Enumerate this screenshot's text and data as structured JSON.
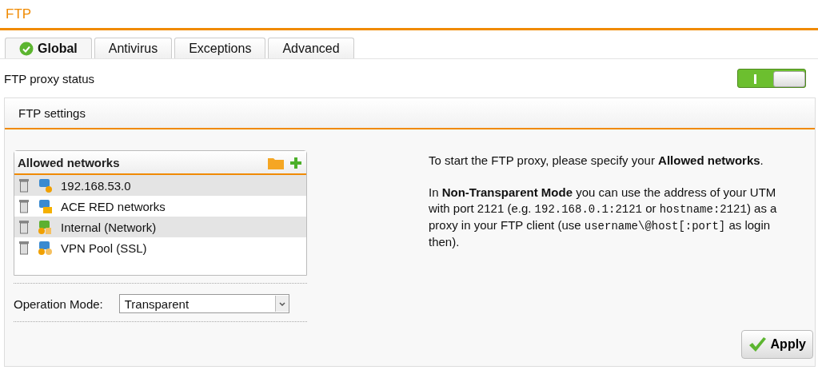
{
  "page_title": "FTP",
  "tabs": [
    {
      "label": "Global",
      "selected": true,
      "status_ok": true
    },
    {
      "label": "Antivirus",
      "selected": false,
      "status_ok": false
    },
    {
      "label": "Exceptions",
      "selected": false,
      "status_ok": false
    },
    {
      "label": "Advanced",
      "selected": false,
      "status_ok": false
    }
  ],
  "proxy_status": {
    "label": "FTP proxy status",
    "on": true
  },
  "panel": {
    "title": "FTP settings",
    "allowed_networks": {
      "title": "Allowed networks",
      "items": [
        {
          "label": "192.168.53.0",
          "kind": "host"
        },
        {
          "label": "ACE RED networks",
          "kind": "group"
        },
        {
          "label": "Internal (Network)",
          "kind": "network"
        },
        {
          "label": "VPN Pool (SSL)",
          "kind": "pool"
        }
      ]
    },
    "operation_mode": {
      "label": "Operation Mode:",
      "value": "Transparent"
    },
    "help": [
      [
        {
          "kind": "text",
          "text": "To start the FTP proxy, please specify your "
        },
        {
          "kind": "bold",
          "text": "Allowed networks"
        },
        {
          "kind": "text",
          "text": "."
        }
      ],
      [
        {
          "kind": "text",
          "text": "In "
        },
        {
          "kind": "bold",
          "text": "Non-Transparent Mode"
        },
        {
          "kind": "text",
          "text": " you can use the address of your UTM with port 2121 (e.g. "
        },
        {
          "kind": "code",
          "text": "192.168.0.1:2121"
        },
        {
          "kind": "text",
          "text": " or "
        },
        {
          "kind": "code",
          "text": "hostname:2121"
        },
        {
          "kind": "text",
          "text": ") as a proxy in your FTP client (use "
        },
        {
          "kind": "code",
          "text": "username\\@host[:port]"
        },
        {
          "kind": "text",
          "text": " as login then)."
        }
      ]
    ],
    "apply": "Apply"
  }
}
